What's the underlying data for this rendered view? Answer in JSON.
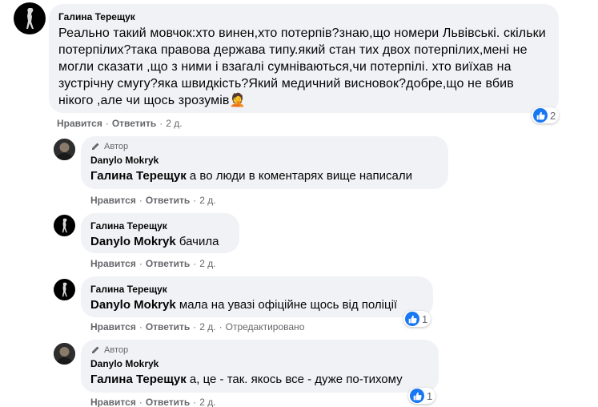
{
  "ui": {
    "like_label": "Нравится",
    "reply_label": "Ответить",
    "separator": "·",
    "author_badge": "Автор",
    "edited_label": "Отредактировано"
  },
  "comments": [
    {
      "author": "Галина Терещук",
      "text": "Реально такий мовчок:хто винен,хто потерпів?знаю,що номери Львівські. скільки потерпілих?така правова держава типу.який стан тих двох потерпілих,мені не могли сказати ,що з ними і взагалі сумніваються,чи потерпілі. хто виїхав на зустрічну смугу?яка швидкість?Який медичний висновок?добре,що не вбив нікого ,але чи щось зрозумів",
      "emoji": "🤦",
      "time": "2 д.",
      "reactions": "2"
    },
    {
      "author": "Danylo Mokryk",
      "mention": "Галина Терещук",
      "text": "а во люди в коментарях вище написали",
      "time": "2 д."
    },
    {
      "author": "Галина Терещук",
      "mention": "Danylo Mokryk",
      "text": "бачила",
      "time": "2 д."
    },
    {
      "author": "Галина Терещук",
      "mention": "Danylo Mokryk",
      "text": "мала на увазі офіційне щось від поліції",
      "time": "2 д.",
      "reactions": "1"
    },
    {
      "author": "Danylo Mokryk",
      "mention": "Галина Терещук",
      "text": "а, це - так. якось все - дуже по-тихому",
      "time": "2 д.",
      "reactions": "1"
    }
  ],
  "icons": {
    "badge": "pencil-icon",
    "reaction": "thumbs-up-icon"
  },
  "colors": {
    "bubble": "#f0f2f5",
    "meta": "#65676b",
    "like": "#1877f2"
  }
}
